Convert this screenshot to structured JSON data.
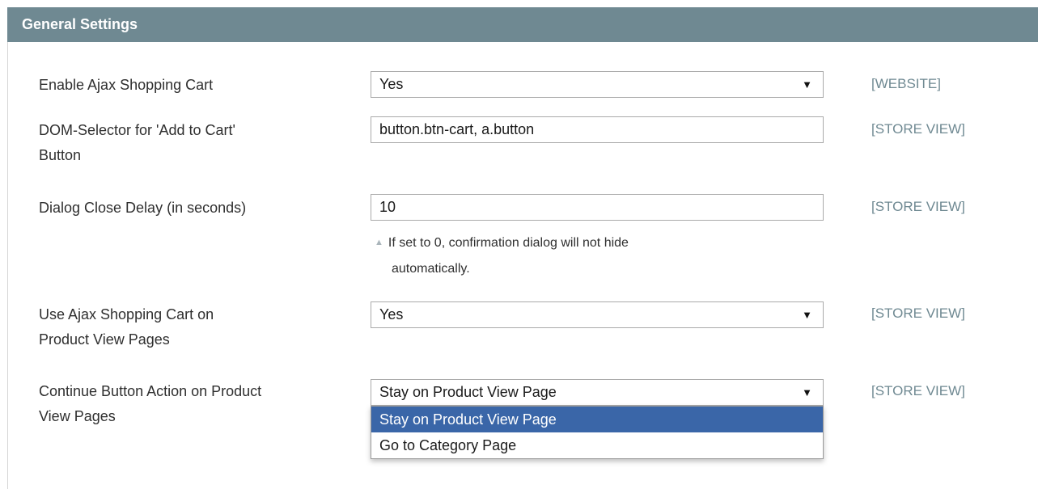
{
  "section": {
    "title": "General Settings"
  },
  "fields": [
    {
      "label": "Enable Ajax Shopping Cart",
      "value": "Yes",
      "scope": "[WEBSITE]"
    },
    {
      "label": "DOM-Selector for 'Add to Cart' Button",
      "value": "button.btn-cart, a.button",
      "scope": "[STORE VIEW]"
    },
    {
      "label": "Dialog Close Delay (in seconds)",
      "value": "10",
      "scope": "[STORE VIEW]",
      "note_line1": "If set to 0, confirmation dialog will not hide",
      "note_line2": "automatically."
    },
    {
      "label_line1": "Use Ajax Shopping Cart on",
      "label_line2": "Product View Pages",
      "value": "Yes",
      "scope": "[STORE VIEW]"
    },
    {
      "label_line1": "Continue Button Action on Product",
      "label_line2": "View Pages",
      "value": "Stay on Product View Page",
      "scope": "[STORE VIEW]",
      "options": [
        "Stay on Product View Page",
        "Go to Category Page"
      ],
      "highlighted_option": 0
    }
  ],
  "dom_label_line1": "DOM-Selector for 'Add to Cart'",
  "dom_label_line2": "Button",
  "icons": {
    "select_arrow": "dropdown-arrow-icon",
    "note": "note-triangle-icon"
  },
  "colors": {
    "header": "#6f8992",
    "scope": "#6f8992",
    "highlight": "#3a66a8"
  }
}
